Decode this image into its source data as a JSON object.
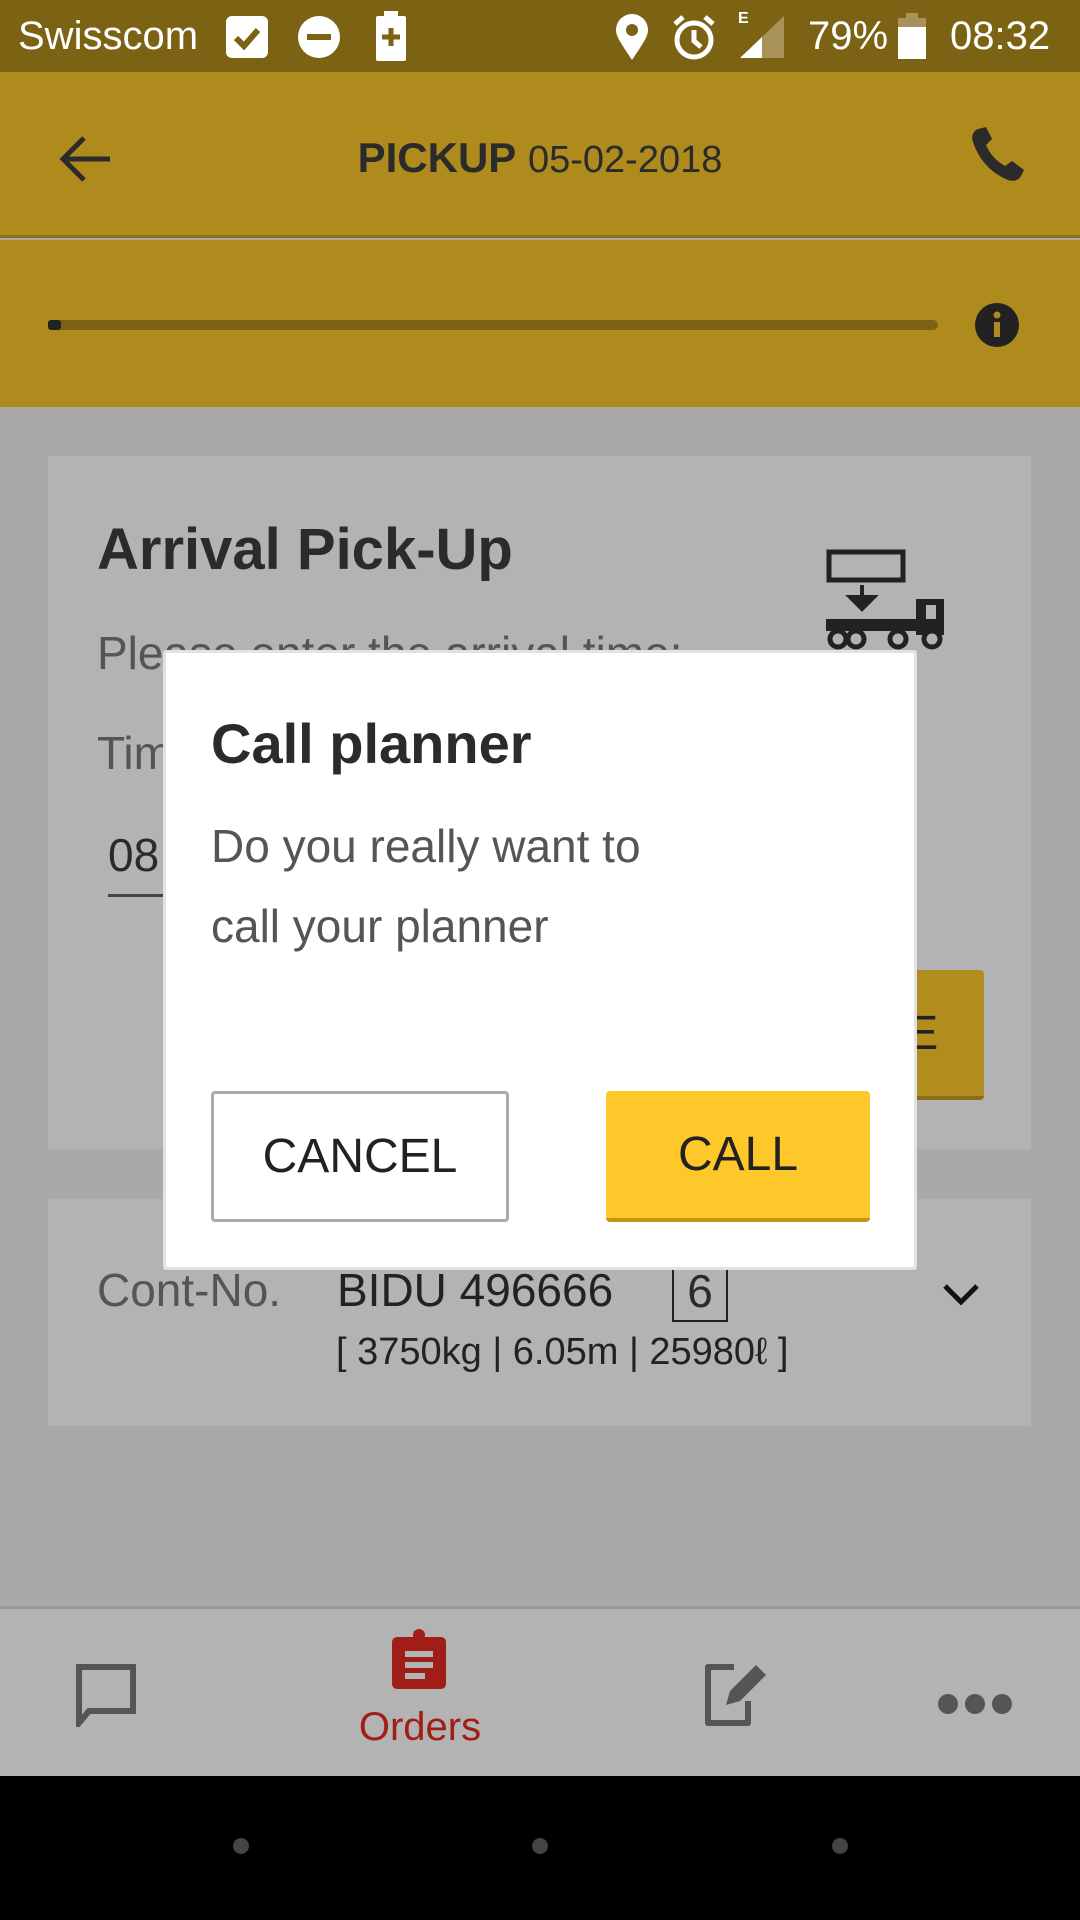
{
  "status_bar": {
    "carrier": "Swisscom",
    "network_type": "E",
    "battery": "79%",
    "time": "08:32"
  },
  "app_bar": {
    "title": "PICKUP",
    "date": "05-02-2018"
  },
  "progress": {
    "value_percent": 1
  },
  "arrival_card": {
    "title": "Arrival Pick-Up",
    "instruction": "Please enter the arrival time:",
    "time_label": "Time",
    "time_value": "08",
    "save_label": "SAVE"
  },
  "container_card": {
    "label": "Cont-No.",
    "number": "BIDU 496666",
    "check_digit": "6",
    "details": "[ 3750kg | 6.05m | 25980ℓ ]"
  },
  "dialog": {
    "title": "Call planner",
    "message_line1": "Do you really want to",
    "message_line2": "call your planner",
    "cancel_label": "CANCEL",
    "call_label": "CALL"
  },
  "bottom_nav": {
    "orders_label": "Orders"
  },
  "colors": {
    "app_bar": "#ae8b1c",
    "accent": "#fec82a",
    "orders_active": "#a11d17"
  }
}
